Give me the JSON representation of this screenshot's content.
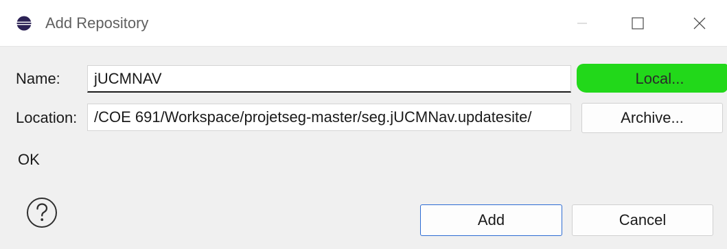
{
  "window": {
    "title": "Add Repository",
    "icons": {
      "app": "eclipse-icon",
      "minimize": "minimize-icon",
      "maximize": "maximize-icon",
      "close": "close-icon"
    }
  },
  "form": {
    "name_label": "Name:",
    "name_value": "jUCMNAV",
    "location_label": "Location:",
    "location_value": "/COE 691/Workspace/projetseg-master/seg.jUCMNav.updatesite/",
    "local_button": "Local...",
    "archive_button": "Archive..."
  },
  "status": {
    "message": "OK"
  },
  "footer": {
    "help_icon": "help-icon",
    "add_button": "Add",
    "cancel_button": "Cancel"
  },
  "colors": {
    "dialog_bg": "#f0f0f0",
    "titlebar_bg": "#ffffff",
    "highlight": "#22d81a",
    "default_button_border": "#2b6bd3"
  }
}
